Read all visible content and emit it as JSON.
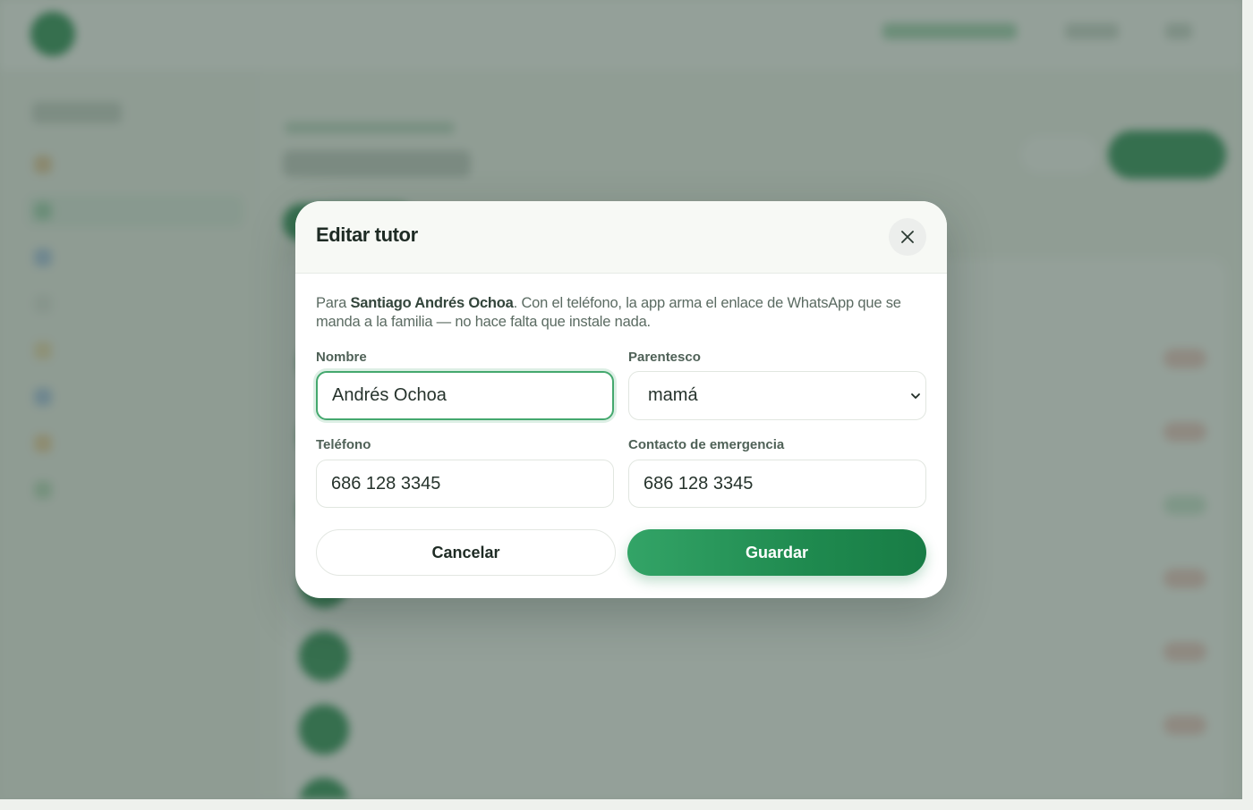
{
  "modal": {
    "title": "Editar tutor",
    "close_icon": "close-icon",
    "description": {
      "prefix": "Para ",
      "student_name": "Santiago Andrés Ochoa",
      "suffix": ". Con el teléfono, la app arma el enlace de WhatsApp que se manda a la familia — no hace falta que instale nada."
    },
    "fields": {
      "nombre": {
        "label": "Nombre",
        "value": "Andrés Ochoa"
      },
      "parentesco": {
        "label": "Parentesco",
        "value": "mamá"
      },
      "telefono": {
        "label": "Teléfono",
        "value": "686 128 3345"
      },
      "contacto_emergencia": {
        "label": "Contacto de emergencia",
        "value": "686 128 3345"
      }
    },
    "buttons": {
      "cancel": "Cancelar",
      "save": "Guardar"
    }
  },
  "colors": {
    "accent": "#1f8a4f",
    "focus_border": "#44a86e",
    "overlay": "rgba(70, 92, 80, 0.58)"
  }
}
